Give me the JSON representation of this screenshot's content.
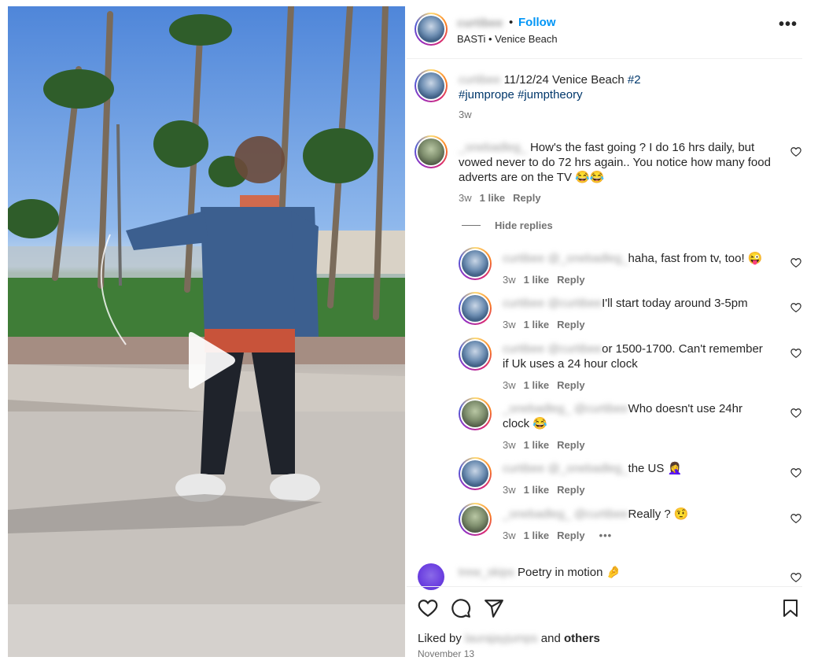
{
  "post": {
    "username": "curtibee",
    "follow_label": "Follow",
    "separator": "•",
    "subtitle": "BASTi • Venice Beach",
    "more_label": "•••",
    "caption": {
      "username": "curtibee",
      "text": "11/12/24 Venice Beach ",
      "tags": [
        "#2",
        "#jumprope",
        "#jumptheory"
      ],
      "time": "3w"
    }
  },
  "comments": [
    {
      "username": "_onebadleg_",
      "text": "How's the fast going ? I do 16 hrs daily, but",
      "text2": "vowed never to do 72 hrs again.. You notice how many food",
      "text3": "adverts are on the TV 😂😂",
      "time": "3w",
      "likes": "1 like",
      "reply": "Reply",
      "hide_replies": "Hide replies",
      "replies": [
        {
          "username": "curtibee",
          "mention": "@_onebadleg_",
          "text": "haha, fast from tv, too! 😜",
          "time": "3w",
          "likes": "1 like",
          "reply": "Reply"
        },
        {
          "username": "curtibee",
          "mention": "@curtibee",
          "text": "I'll start today around 3-5pm",
          "time": "3w",
          "likes": "1 like",
          "reply": "Reply"
        },
        {
          "username": "curtibee",
          "mention": "@curtibee",
          "text": "or 1500-1700. Can't remember",
          "text2": "if Uk uses a 24 hour clock",
          "time": "3w",
          "likes": "1 like",
          "reply": "Reply"
        },
        {
          "username": "_onebadleg_",
          "mention": "@curtibee",
          "text": "Who doesn't use 24hr",
          "text2": "clock 😂",
          "time": "3w",
          "likes": "1 like",
          "reply": "Reply"
        },
        {
          "username": "curtibee",
          "mention": "@_onebadleg_",
          "text": "the US 🤦‍♀️",
          "time": "3w",
          "likes": "1 like",
          "reply": "Reply"
        },
        {
          "username": "_onebadleg_",
          "mention": "@curtibee",
          "text": "Really ? 🤨",
          "time": "3w",
          "likes": "1 like",
          "reply": "Reply",
          "more": "•••"
        }
      ]
    },
    {
      "username": "trew_skips",
      "text": "Poetry in motion 🤌"
    }
  ],
  "footer": {
    "liked_prefix": "Liked by ",
    "liked_user": "laurajayjumps",
    "liked_mid": " and ",
    "liked_others": "others",
    "date": "November 13"
  },
  "icons": {
    "like": "heart-icon",
    "comment": "comment-icon",
    "share": "share-icon",
    "save": "bookmark-icon",
    "play": "play-icon"
  },
  "colors": {
    "follow": "#0095f6",
    "hashtag": "#00376b",
    "muted": "#737373"
  }
}
